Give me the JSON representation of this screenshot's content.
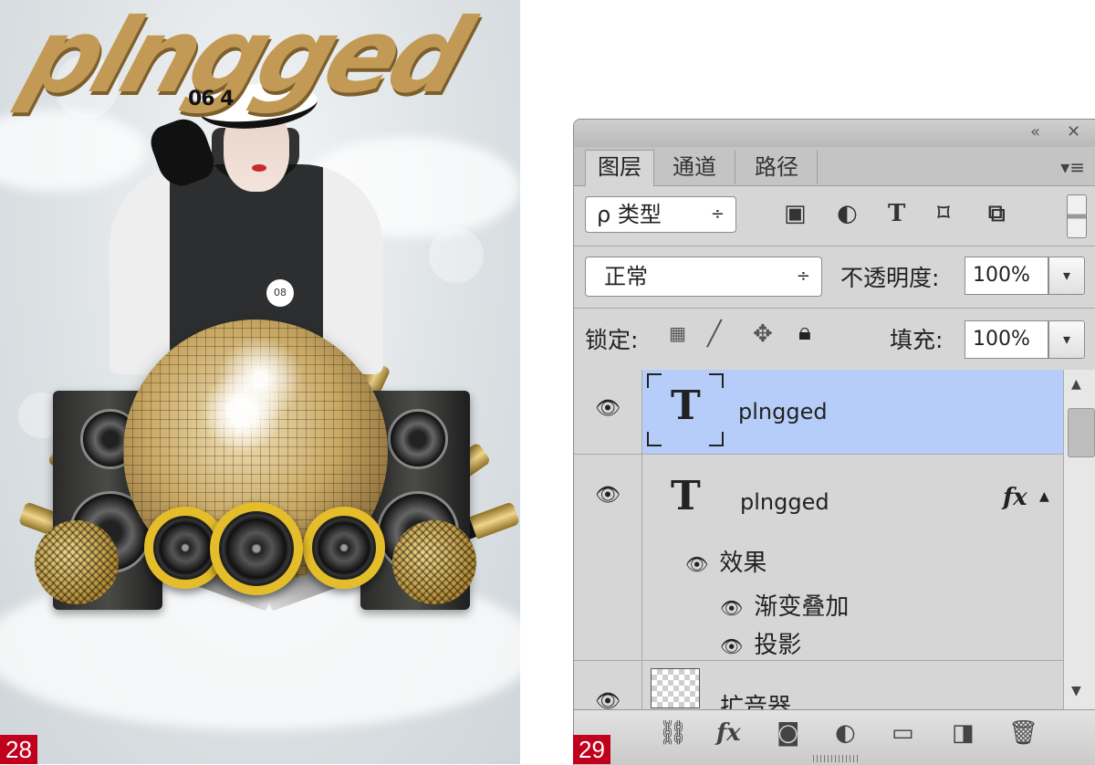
{
  "figures": {
    "left_number": "28",
    "right_number": "29"
  },
  "poster": {
    "title": "plngged",
    "issue": "06 4",
    "badge": "08"
  },
  "panel": {
    "titlebar": {
      "collapse_icon": "«",
      "close_icon": "✕"
    },
    "tabs": [
      {
        "label": "图层",
        "active": true
      },
      {
        "label": "通道",
        "active": false
      },
      {
        "label": "路径",
        "active": false
      }
    ],
    "menu_icon": "▾≡",
    "filter": {
      "label": "ρ 类型",
      "arrow": "÷"
    },
    "filter_icons": [
      "image-filter-icon",
      "adjustment-filter-icon",
      "text-filter-icon",
      "shape-filter-icon",
      "smart-object-filter-icon"
    ],
    "blend": {
      "mode": "正常",
      "arrow": "÷",
      "opacity_label": "不透明度:",
      "opacity_value": "100%"
    },
    "lock": {
      "label": "锁定:",
      "fill_label": "填充:",
      "fill_value": "100%"
    },
    "layers": [
      {
        "name": "plngged",
        "type": "text",
        "selected": true,
        "has_fx": false
      },
      {
        "name": "plngged",
        "type": "text",
        "selected": false,
        "has_fx": true,
        "fx_label": "fx",
        "effects_label": "效果",
        "effects": [
          "渐变叠加",
          "投影"
        ]
      },
      {
        "name": "扩音器",
        "type": "raster",
        "selected": false,
        "has_fx": false
      }
    ],
    "selected_color": "#b7cdf9",
    "bottom_icons": [
      "link-icon",
      "fx-icon",
      "mask-icon",
      "adjustment-icon",
      "group-folder-icon",
      "new-layer-icon",
      "trash-icon"
    ],
    "bottom_fx_label": "fx"
  }
}
